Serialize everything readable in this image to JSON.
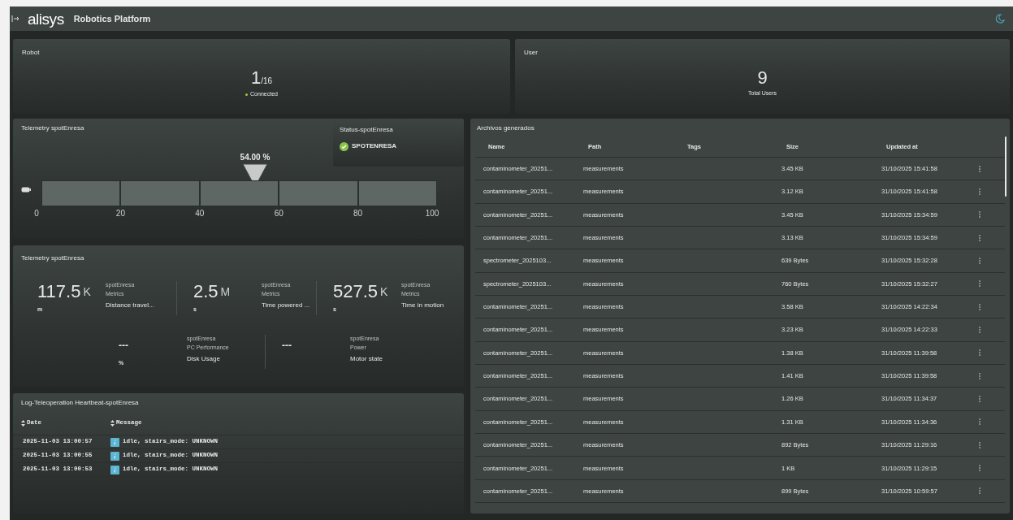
{
  "header": {
    "logo": "alisys",
    "title": "Robotics Platform"
  },
  "robot_card": {
    "title": "Robot",
    "value": "1",
    "total": "/16",
    "status": "Connected"
  },
  "user_card": {
    "title": "User",
    "value": "9",
    "caption": "Total Users"
  },
  "gauge_panel": {
    "title": "Telemetry spotEnresa",
    "reading": "54.00 %",
    "level": 0.54,
    "ticks": [
      "0",
      "20",
      "40",
      "60",
      "80",
      "100"
    ]
  },
  "status_panel": {
    "title": "Status-spotEnresa",
    "items": [
      {
        "label": "SPOTENRESA",
        "ok": true
      }
    ]
  },
  "metrics_panel": {
    "title": "Telemetry spotEnresa",
    "rows": [
      [
        {
          "value": "117.5",
          "suffix": "K",
          "unit": "m",
          "source": "spotEnresa",
          "group": "Metrics",
          "label": "Distance travel..."
        },
        {
          "value": "2.5",
          "suffix": "M",
          "unit": "s",
          "source": "spotEnresa",
          "group": "Metrics",
          "label": "Time powered ..."
        },
        {
          "value": "527.5",
          "suffix": "K",
          "unit": "s",
          "source": "spotEnresa",
          "group": "Metrics",
          "label": "Time in motion"
        }
      ],
      [
        {
          "value": "---",
          "unit": "%",
          "source": "spotEnresa",
          "group": "PC Performance",
          "label": "Disk Usage"
        },
        {
          "value": "---",
          "source": "spotEnresa",
          "group": "Power",
          "label": "Motor state"
        }
      ]
    ]
  },
  "log_panel": {
    "title": "Log-Teleoperation Heartbeat-spotEnresa",
    "columns": [
      "Date",
      "Message"
    ],
    "rows": [
      {
        "date": "2025-11-03 13:00:57",
        "kind": "info",
        "message": "idle, stairs_mode: UNKNOWN"
      },
      {
        "date": "2025-11-03 13:00:55",
        "kind": "info",
        "message": "idle, stairs_mode: UNKNOWN"
      },
      {
        "date": "2025-11-03 13:00:53",
        "kind": "info",
        "message": "idle, stairs_mode: UNKNOWN"
      }
    ]
  },
  "files_panel": {
    "title": "Archivos generados",
    "columns": [
      "Name",
      "Path",
      "Tags",
      "Size",
      "Updated at"
    ],
    "rows": [
      {
        "name": "contaminometer_20251...",
        "path": "measurements",
        "size": "3.45 KB",
        "updated": "31/10/2025 15:41:58"
      },
      {
        "name": "contaminometer_20251...",
        "path": "measurements",
        "size": "3.12 KB",
        "updated": "31/10/2025 15:41:58"
      },
      {
        "name": "contaminometer_20251...",
        "path": "measurements",
        "size": "3.45 KB",
        "updated": "31/10/2025 15:34:59"
      },
      {
        "name": "contaminometer_20251...",
        "path": "measurements",
        "size": "3.13 KB",
        "updated": "31/10/2025 15:34:59"
      },
      {
        "name": "spectrometer_2025103...",
        "path": "measurements",
        "size": "639 Bytes",
        "updated": "31/10/2025 15:32:28"
      },
      {
        "name": "spectrometer_2025103...",
        "path": "measurements",
        "size": "760 Bytes",
        "updated": "31/10/2025 15:32:27"
      },
      {
        "name": "contaminometer_20251...",
        "path": "measurements",
        "size": "3.58 KB",
        "updated": "31/10/2025 14:22:34"
      },
      {
        "name": "contaminometer_20251...",
        "path": "measurements",
        "size": "3.23 KB",
        "updated": "31/10/2025 14:22:33"
      },
      {
        "name": "contaminometer_20251...",
        "path": "measurements",
        "size": "1.38 KB",
        "updated": "31/10/2025 11:39:58"
      },
      {
        "name": "contaminometer_20251...",
        "path": "measurements",
        "size": "1.41 KB",
        "updated": "31/10/2025 11:39:58"
      },
      {
        "name": "contaminometer_20251...",
        "path": "measurements",
        "size": "1.26 KB",
        "updated": "31/10/2025 11:34:37"
      },
      {
        "name": "contaminometer_20251...",
        "path": "measurements",
        "size": "1.31 KB",
        "updated": "31/10/2025 11:34:36"
      },
      {
        "name": "contaminometer_20251...",
        "path": "measurements",
        "size": "892 Bytes",
        "updated": "31/10/2025 11:29:16"
      },
      {
        "name": "contaminometer_20251...",
        "path": "measurements",
        "size": "1 KB",
        "updated": "31/10/2025 11:29:15"
      },
      {
        "name": "contaminometer_20251...",
        "path": "measurements",
        "size": "899 Bytes",
        "updated": "31/10/2025 10:59:57"
      }
    ]
  }
}
